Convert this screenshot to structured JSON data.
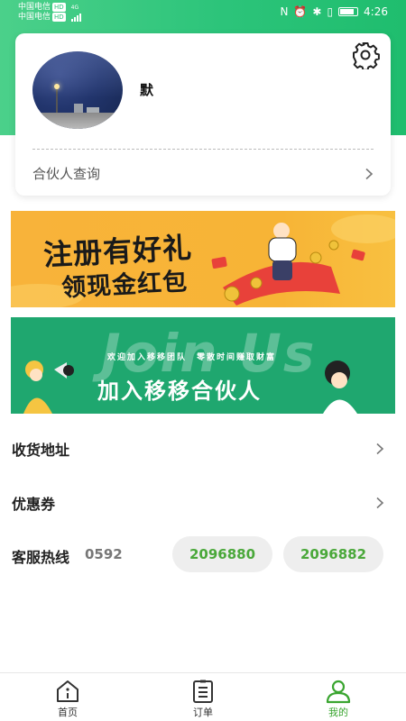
{
  "status_bar": {
    "carrier1": "中国电信",
    "carrier2": "中国电信",
    "hd": "HD",
    "network": "4G",
    "time": "4:26"
  },
  "profile": {
    "username": "默",
    "partner_query_label": "合伙人查询"
  },
  "banners": {
    "gift": {
      "line1": "注册有好礼",
      "line2": "领现金红包"
    },
    "join": {
      "watermark": "Join Us",
      "slogan": "欢迎加入移移团队　零散时间赚取财富",
      "headline": "加入移移合伙人"
    }
  },
  "menu": {
    "address_label": "收货地址",
    "coupon_label": "优惠券"
  },
  "hotline": {
    "label": "客服热线",
    "area_code": "0592",
    "phone1": "2096880",
    "phone2": "2096882"
  },
  "tabbar": {
    "home": "首页",
    "orders": "订单",
    "mine": "我的"
  },
  "colors": {
    "brand_green": "#2cc47a",
    "accent_green": "#3aa530",
    "banner_yellow": "#f7b436",
    "banner_green": "#1fa76f"
  }
}
